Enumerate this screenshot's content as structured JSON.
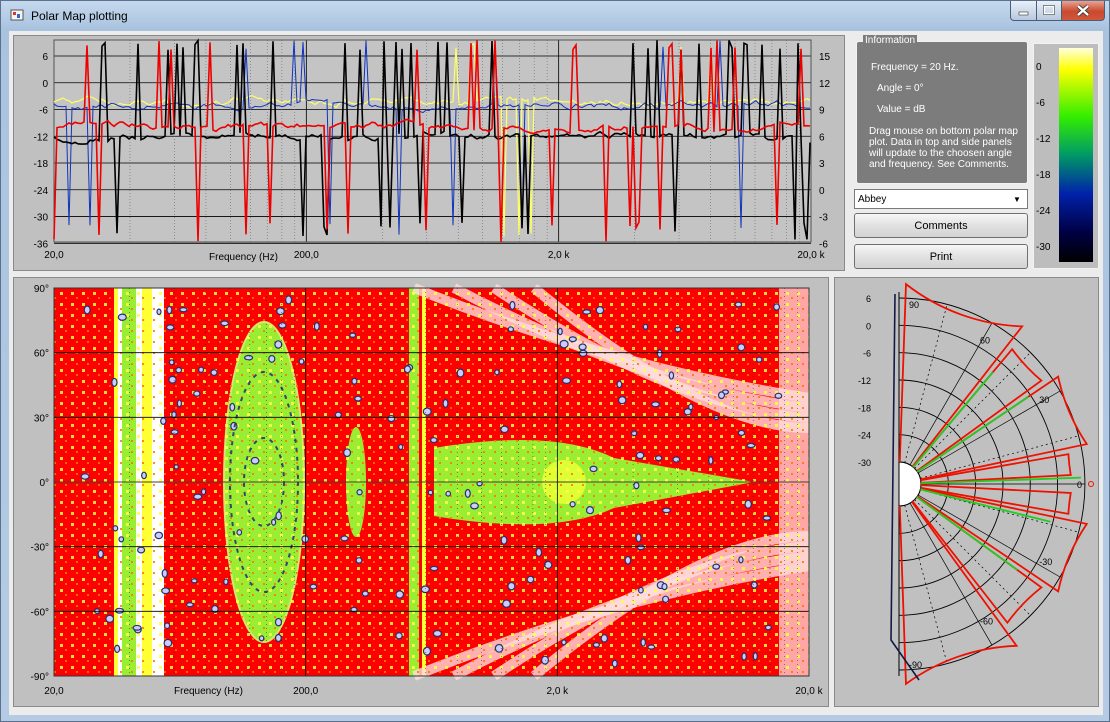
{
  "window": {
    "title": "Polar Map plotting"
  },
  "info": {
    "legend": "Information",
    "frequency": "Frequency = 20 Hz.",
    "angle": "Angle = 0°",
    "value": "Value =  dB",
    "help": [
      "Drag mouse on bottom polar map",
      "plot.  Data in top and side panels",
      "will update to the choosen angle",
      "and frequency.  See Comments."
    ]
  },
  "dropdown": {
    "selected": "Abbey"
  },
  "buttons": {
    "comments": "Comments",
    "print": "Print"
  },
  "colorscale": {
    "labels": [
      "0",
      "-6",
      "-12",
      "-18",
      "-24",
      "-30"
    ],
    "colors": [
      "#ffffcc",
      "#ffff00",
      "#00ee00",
      "#00aa55",
      "#003399",
      "#000000"
    ]
  },
  "top_plot": {
    "y_left_ticks": [
      "6",
      "0",
      "-6",
      "-12",
      "-18",
      "-24",
      "-30",
      "-36"
    ],
    "y_right_ticks": [
      "15",
      "12",
      "9",
      "6",
      "3",
      "0",
      "-3",
      "-6"
    ],
    "x_ticks": [
      "20,0",
      "200,0",
      "2,0 k",
      "20,0 k"
    ],
    "xlabel": "Frequency (Hz)"
  },
  "map_plot": {
    "y_ticks": [
      "90°",
      "60°",
      "30°",
      "0°",
      "-30°",
      "-60°",
      "-90°"
    ],
    "x_ticks": [
      "20,0",
      "200,0",
      "2,0 k",
      "20,0 k"
    ],
    "xlabel": "Frequency (Hz)",
    "colors": {
      "red": "#ff0000",
      "yellow": "#ffff33",
      "green": "#99ee33",
      "white": "#ffffff"
    }
  },
  "polar_plot": {
    "radial_ticks": [
      "6",
      "0",
      "-6",
      "-12",
      "-18",
      "-24",
      "-30"
    ],
    "angle_labels": [
      "90",
      "60",
      "30",
      "0",
      "-30",
      "-60",
      "-90"
    ]
  }
}
